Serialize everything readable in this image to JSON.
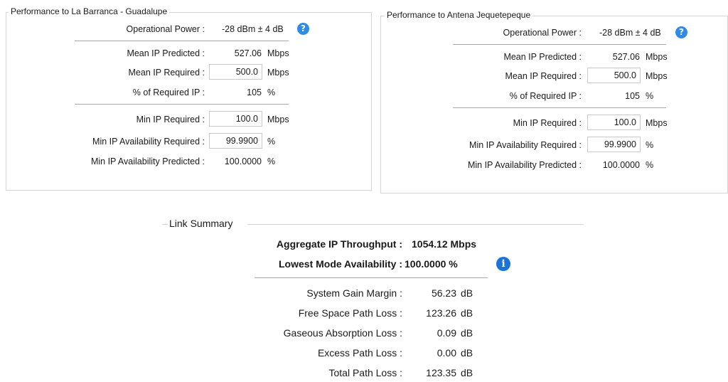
{
  "left": {
    "title": "Performance to La Barranca - Guadalupe",
    "operational_power_label": "Operational Power :",
    "operational_power_value": "-28 dBm ± 4 dB",
    "mean_ip_predicted_label": "Mean IP Predicted :",
    "mean_ip_predicted_value": "527.06",
    "mean_ip_predicted_unit": "Mbps",
    "mean_ip_required_label": "Mean IP Required :",
    "mean_ip_required_value": "500.0",
    "mean_ip_required_unit": "Mbps",
    "pct_required_label": "% of Required IP :",
    "pct_required_value": "105",
    "pct_required_unit": "%",
    "min_ip_required_label": "Min IP Required :",
    "min_ip_required_value": "100.0",
    "min_ip_required_unit": "Mbps",
    "min_avail_required_label": "Min IP Availability Required :",
    "min_avail_required_value": "99.9900",
    "min_avail_required_unit": "%",
    "min_avail_predicted_label": "Min IP Availability Predicted :",
    "min_avail_predicted_value": "100.0000",
    "min_avail_predicted_unit": "%"
  },
  "right": {
    "title": "Performance to Antena Jequetepeque",
    "operational_power_label": "Operational Power :",
    "operational_power_value": "-28 dBm ± 4 dB",
    "mean_ip_predicted_label": "Mean IP Predicted :",
    "mean_ip_predicted_value": "527.06",
    "mean_ip_predicted_unit": "Mbps",
    "mean_ip_required_label": "Mean IP Required :",
    "mean_ip_required_value": "500.0",
    "mean_ip_required_unit": "Mbps",
    "pct_required_label": "% of Required IP :",
    "pct_required_value": "105",
    "pct_required_unit": "%",
    "min_ip_required_label": "Min IP Required :",
    "min_ip_required_value": "100.0",
    "min_ip_required_unit": "Mbps",
    "min_avail_required_label": "Min IP Availability Required :",
    "min_avail_required_value": "99.9900",
    "min_avail_required_unit": "%",
    "min_avail_predicted_label": "Min IP Availability Predicted :",
    "min_avail_predicted_value": "100.0000",
    "min_avail_predicted_unit": "%"
  },
  "summary": {
    "title": "Link Summary",
    "aggregate_label": "Aggregate IP Throughput :",
    "aggregate_value": "1054.12 Mbps",
    "lowest_mode_label": "Lowest Mode Availability :",
    "lowest_mode_value": "100.0000 %",
    "rows": [
      {
        "label": "System Gain Margin :",
        "value": "56.23",
        "unit": "dB"
      },
      {
        "label": "Free Space Path Loss :",
        "value": "123.26",
        "unit": "dB"
      },
      {
        "label": "Gaseous Absorption Loss :",
        "value": "0.09",
        "unit": "dB"
      },
      {
        "label": "Excess Path Loss :",
        "value": "0.00",
        "unit": "dB"
      },
      {
        "label": "Total Path Loss :",
        "value": "123.35",
        "unit": "dB"
      }
    ]
  },
  "icons": {
    "help": "question-icon",
    "info": "info-icon",
    "help_glyph": "?",
    "info_glyph": "i",
    "accent": "#2f8be6"
  }
}
